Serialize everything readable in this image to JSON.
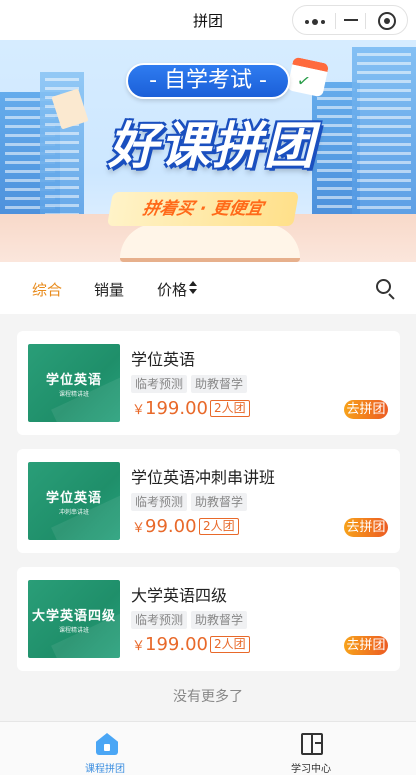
{
  "navbar": {
    "title": "拼团"
  },
  "banner": {
    "subject": "- 自学考试 -",
    "headline": "好课拼团",
    "slogan": "拼着买 · 更便宜"
  },
  "filter": {
    "tabs": [
      "综合",
      "销量",
      "价格"
    ],
    "active_color": "#e88b1c"
  },
  "courses": [
    {
      "thumb_title": "学位英语",
      "thumb_subtitle": "课程精讲班",
      "title": "学位英语",
      "tags": [
        "临考预测",
        "助教督学"
      ],
      "currency": "￥",
      "price": "199.00",
      "group": "2人团",
      "action": "去拼团"
    },
    {
      "thumb_title": "学位英语",
      "thumb_subtitle": "冲刺串讲班",
      "title": "学位英语冲刺串讲班",
      "tags": [
        "临考预测",
        "助教督学"
      ],
      "currency": "￥",
      "price": "99.00",
      "group": "2人团",
      "action": "去拼团"
    },
    {
      "thumb_title": "大学英语四级",
      "thumb_subtitle": "课程精讲班",
      "title": "大学英语四级",
      "tags": [
        "临考预测",
        "助教督学"
      ],
      "currency": "￥",
      "price": "199.00",
      "group": "2人团",
      "action": "去拼团"
    }
  ],
  "list_end_text": "没有更多了",
  "tabbar": {
    "items": [
      {
        "label": "课程拼团",
        "icon": "home-icon",
        "active": true
      },
      {
        "label": "学习中心",
        "icon": "book-icon",
        "active": false
      }
    ]
  },
  "colors": {
    "price": "#e8692a",
    "join_button_start": "#f7a21b",
    "join_button_end": "#ec5b22",
    "thumb_green": "#2a9e78",
    "tab_active_blue": "#3d8fe0"
  }
}
